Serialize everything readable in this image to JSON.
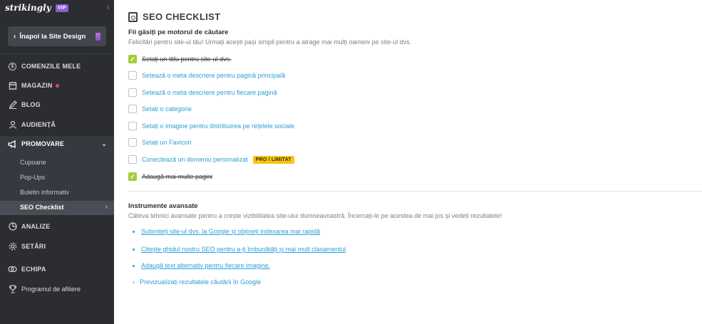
{
  "brand": {
    "logo": "strikingly",
    "vip": "VIP"
  },
  "sidebar": {
    "collapse_glyph": "‹",
    "back_button": {
      "chevron": "‹",
      "label": "Înapoi la Site Design"
    },
    "items": [
      {
        "label": "COMENZILE MELE",
        "icon": "dollar-icon"
      },
      {
        "label": "MAGAZIN",
        "icon": "store-icon"
      },
      {
        "label": "BLOG",
        "icon": "pen-icon"
      },
      {
        "label": "AUDIENȚĂ",
        "icon": "user-icon"
      },
      {
        "label": "PROMOVARE",
        "icon": "megaphone-icon"
      },
      {
        "label": "ANALIZE",
        "icon": "chart-icon"
      },
      {
        "label": "SETĂRI",
        "icon": "gear-icon"
      },
      {
        "label": "ECHIPA",
        "icon": "team-icon"
      },
      {
        "label": "Programul de afiliere",
        "icon": "trophy-icon"
      }
    ],
    "promo_sub": [
      "Cupoane",
      "Pop-Ups",
      "Buletin informativ",
      "SEO Checklist"
    ],
    "chev_down": "⌄",
    "chev_right": "›"
  },
  "main": {
    "title": "SEO CHECKLIST",
    "search_section": {
      "title": "Fii găsiți pe motorul de căutare",
      "desc": "Felicitări pentru site-ul tău! Urmați acești pași simpli pentru a atrage mai mulți oameni pe site-ul dvs."
    },
    "checklist": [
      {
        "label": "Setați un titlu pentru site-ul dvs.",
        "done": true
      },
      {
        "label": "Setează o meta descriere pentru pagină principală",
        "done": false
      },
      {
        "label": "Setează o meta descriere pentru fiecare pagină",
        "done": false
      },
      {
        "label": "Setați o categorie",
        "done": false
      },
      {
        "label": "Setați o imagine pentru distribuirea pe rețelele sociale",
        "done": false
      },
      {
        "label": "Setați un Favicon",
        "done": false
      },
      {
        "label": "Conectează un domeniu personalizat",
        "done": false,
        "badge": "PRO / LIMITAT"
      },
      {
        "label": "Adaugă mai multe pagini",
        "done": true
      }
    ],
    "check_glyph": "✓",
    "advanced": {
      "title": "Instrumente avansate",
      "desc": "Câteva tehnici avansate pentru a crește vizibilitatea site-ului dumneavoastră. Încercați-le pe acestea de mai jos și vedeți rezultatele!",
      "links": [
        "Submiteți site-ul dvs. la Google și obțineți indexarea mai rapidă",
        "Citește ghidul nostru SEO pentru a-ți îmbunătăți și mai mult clasamentul",
        "Adaugă text alternativ pentru fiecare imagine."
      ],
      "preview": {
        "chevron": "›",
        "label": "Previzualizați rezultatele căutării în Google"
      }
    }
  },
  "colors": {
    "sidebar_bg": "#2b2d31",
    "accent_link": "#2b9fd6",
    "check_green": "#a6cc3b",
    "badge_yellow": "#f5c518",
    "vip_purple": "#8a5fd1",
    "notify_red": "#e2464d"
  }
}
